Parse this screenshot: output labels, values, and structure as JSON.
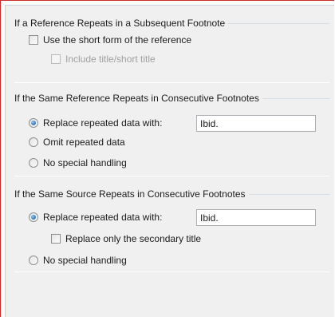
{
  "group1": {
    "title": "If a Reference Repeats in a Subsequent Footnote",
    "use_short_form": {
      "label": "Use the short form of the reference",
      "checked": false
    },
    "include_title": {
      "label": "Include title/short title",
      "checked": false,
      "enabled": false
    }
  },
  "group2": {
    "title": "If the Same Reference Repeats in Consecutive Footnotes",
    "options": [
      {
        "label": "Replace repeated data with:",
        "selected": true
      },
      {
        "label": "Omit repeated data",
        "selected": false
      },
      {
        "label": "No special handling",
        "selected": false
      }
    ],
    "replace_value": "Ibid."
  },
  "group3": {
    "title": "If the Same Source Repeats in Consecutive Footnotes",
    "options": [
      {
        "label": "Replace repeated data with:",
        "selected": true
      },
      {
        "label": "No special handling",
        "selected": false
      }
    ],
    "replace_value": "Ibid.",
    "secondary_title": {
      "label": "Replace only the secondary title",
      "checked": false
    }
  }
}
